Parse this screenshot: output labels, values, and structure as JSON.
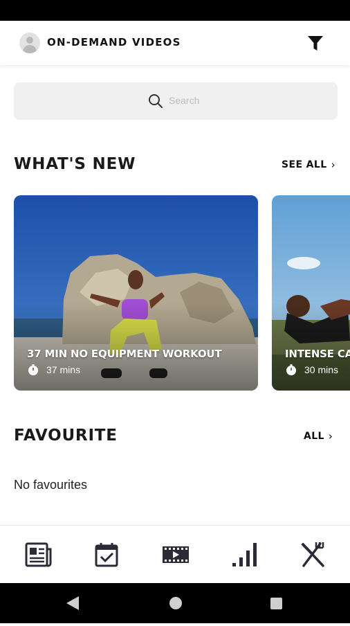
{
  "header": {
    "title": "ON-DEMAND VIDEOS",
    "avatar_icon": "user-avatar-icon",
    "filter_icon": "filter-icon"
  },
  "search": {
    "placeholder": "Search",
    "icon": "search-icon"
  },
  "whats_new": {
    "title": "WHAT'S NEW",
    "see_all_label": "SEE ALL",
    "cards": [
      {
        "title": "37 MIN NO EQUIPMENT WORKOUT",
        "duration": "37 mins"
      },
      {
        "title": "INTENSE CA",
        "duration": "30 mins"
      }
    ]
  },
  "favourite": {
    "title": "FAVOURITE",
    "all_label": "ALL",
    "empty_text": "No favourites"
  },
  "bottom_nav": {
    "items": [
      "news-icon",
      "calendar-check-icon",
      "video-icon",
      "stats-icon",
      "nutrition-icon"
    ]
  },
  "colors": {
    "accent": "#111111",
    "sky": "#2f63b3",
    "background": "#ffffff"
  }
}
